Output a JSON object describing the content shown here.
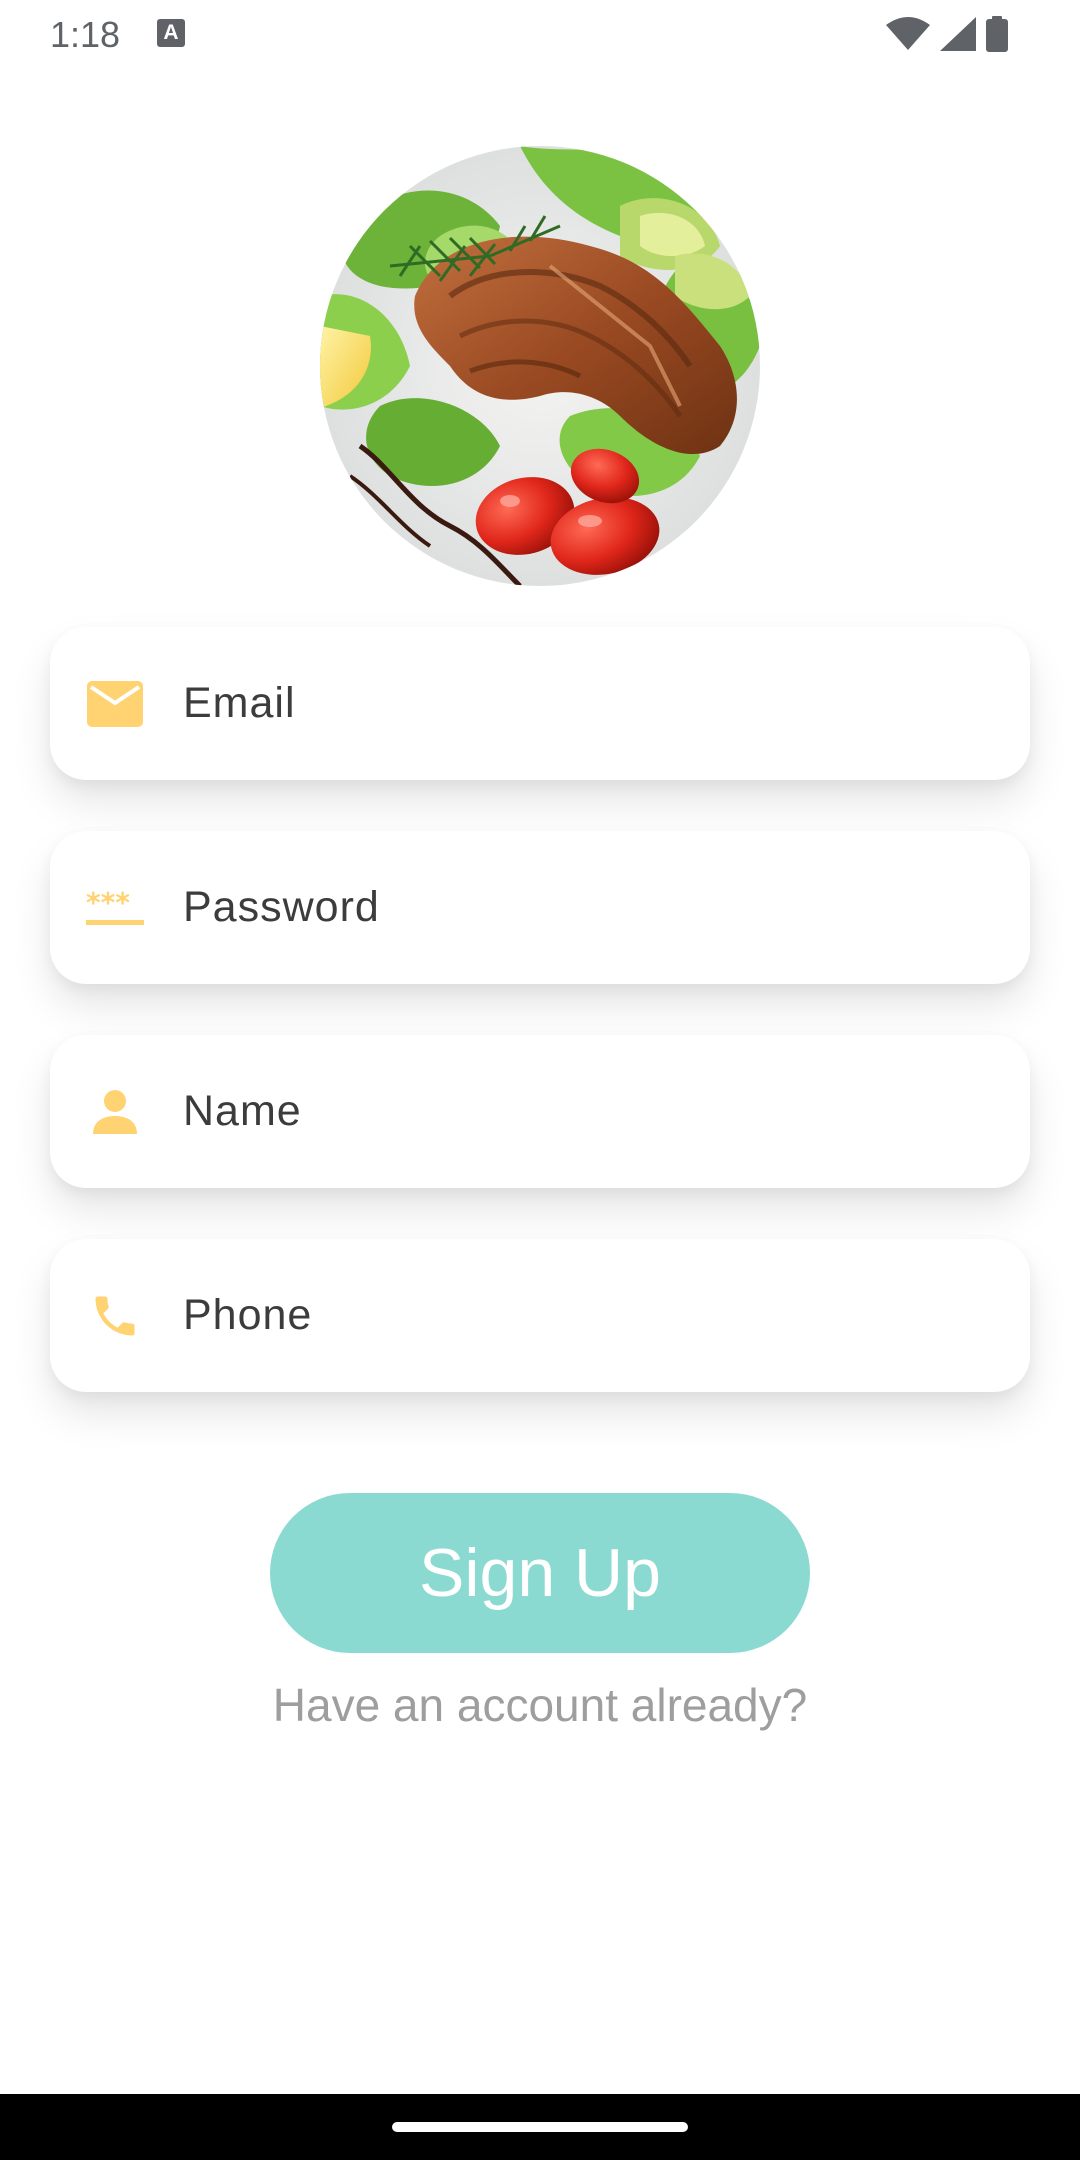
{
  "status_bar": {
    "time": "1:18",
    "notification_icon": "keyboard-a-icon",
    "notification_letter": "A",
    "icons": [
      "wifi-icon",
      "cellular-signal-icon",
      "battery-icon"
    ]
  },
  "hero_image": {
    "icon": "grilled-salmon-salad-photo"
  },
  "form": {
    "email": {
      "placeholder": "Email",
      "icon": "email-icon"
    },
    "password": {
      "placeholder": "Password",
      "icon": "password-icon"
    },
    "name": {
      "placeholder": "Name",
      "icon": "person-icon"
    },
    "phone": {
      "placeholder": "Phone",
      "icon": "phone-icon"
    }
  },
  "actions": {
    "signup_label": "Sign Up",
    "have_account_label": "Have an account already?"
  },
  "colors": {
    "icon_accent": "#FFD272",
    "button_bg": "#8BDAD1",
    "link_text": "#9E9E9E",
    "input_text": "#3C3C3C"
  }
}
